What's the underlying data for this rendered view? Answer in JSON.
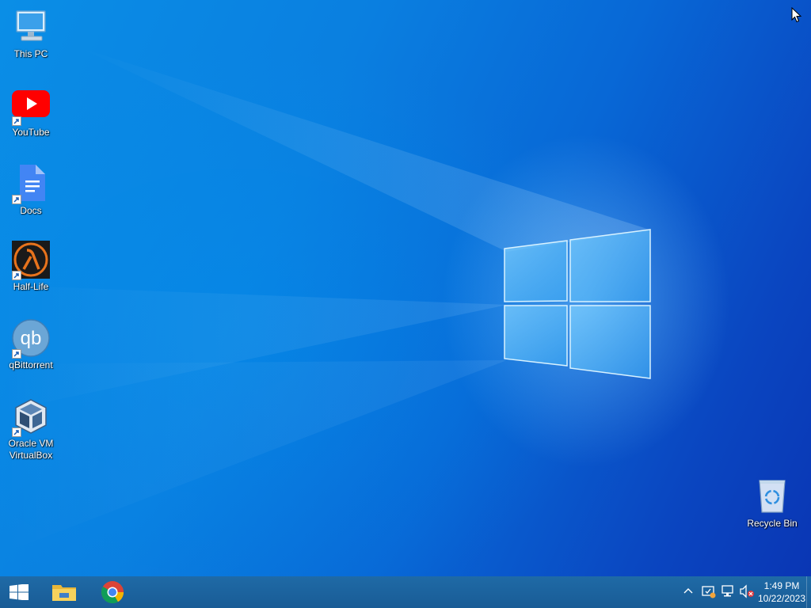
{
  "desktop": {
    "icons": [
      {
        "label": "This PC",
        "icon": "computer-icon",
        "shortcut": false
      },
      {
        "label": "YouTube",
        "icon": "youtube-icon",
        "shortcut": true
      },
      {
        "label": "Docs",
        "icon": "google-docs-icon",
        "shortcut": true
      },
      {
        "label": "Half-Life",
        "icon": "half-life-icon",
        "shortcut": true
      },
      {
        "label": "qBittorrent",
        "icon": "qbittorrent-icon",
        "shortcut": true
      },
      {
        "label": "Oracle VM VirtualBox",
        "icon": "virtualbox-icon",
        "shortcut": true
      },
      {
        "label": "Recycle Bin",
        "icon": "recycle-bin-icon",
        "shortcut": false
      }
    ]
  },
  "taskbar": {
    "start": {
      "icon": "windows-start-icon"
    },
    "pinned": [
      {
        "icon": "file-explorer-icon"
      },
      {
        "icon": "chrome-icon"
      }
    ],
    "tray": {
      "icons": [
        "chevron-up-icon",
        "security-center-icon",
        "network-icon",
        "volume-muted-icon"
      ]
    },
    "clock": {
      "time": "1:49 PM",
      "date": "10/22/2023"
    }
  },
  "colors": {
    "accent": "#0a7fe0",
    "taskbar": "#1d5f9c",
    "youtube_red": "#ff0000",
    "docs_blue": "#4285f4"
  }
}
